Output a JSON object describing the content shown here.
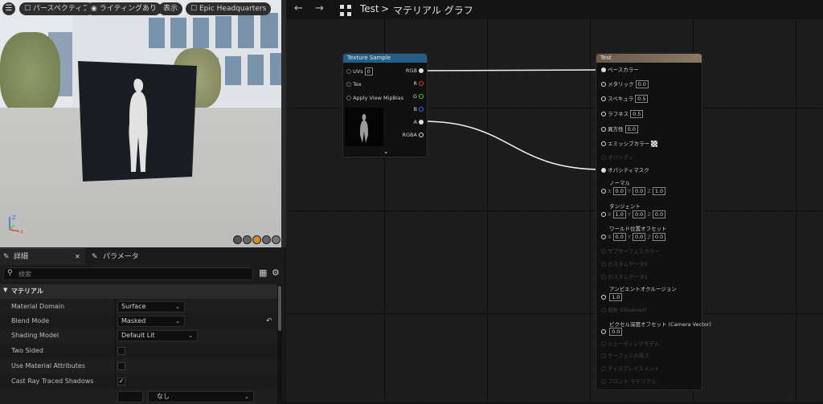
{
  "viewport": {
    "mode_label": "パースペクティブ",
    "lighting_label": "ライティングあり",
    "show_label": "表示",
    "level_label": "Epic Headquarters"
  },
  "graph": {
    "breadcrumb_root": "Test",
    "breadcrumb_sep": ">",
    "breadcrumb_page": "マテリアル グラフ"
  },
  "texture_node": {
    "title": "Texture Sample",
    "inputs": [
      "UVs",
      "Tex",
      "Apply View MipBias"
    ],
    "uvs_value": "0",
    "outputs": [
      "RGB",
      "R",
      "G",
      "B",
      "A",
      "RGBA"
    ]
  },
  "result_node": {
    "title": "Test",
    "base_color": "ベースカラー",
    "metallic": "メタリック",
    "metallic_value": "0.0",
    "specular": "スペキュラ",
    "specular_value": "0.5",
    "roughness": "ラフネス",
    "roughness_value": "0.5",
    "anisotropy": "異方性",
    "anisotropy_value": "0.0",
    "emissive": "エミッシブカラー",
    "opacity": "オパシティ",
    "opacity_mask": "オパシティマスク",
    "normal": "ノーマル",
    "normal_x": "0.0",
    "normal_y": "0.0",
    "normal_z": "1.0",
    "tangent": "タンジェント",
    "tangent_x": "1.0",
    "tangent_y": "0.0",
    "tangent_z": "0.0",
    "wpo": "ワールド位置オフセット",
    "wpo_x": "0.0",
    "wpo_y": "0.0",
    "wpo_z": "0.0",
    "subsurface": "サブサーフェスカラー",
    "custom0": "カスタムデータ0",
    "custom1": "カスタムデータ1",
    "ao": "アンビエントオクルージョン",
    "ao_value": "1.0",
    "refraction": "屈折 (Disabled)",
    "pdo": "ピクセル深度オフセット (Camera Vector)",
    "pdo_value": "0.0",
    "shading_model": "シェーディングモデル",
    "surface_thickness": "サーフェスの厚さ",
    "displacement": "ディスプレイスメント",
    "front_material": "フロント マテリアル",
    "axis_x": "X",
    "axis_y": "Y",
    "axis_z": "Z"
  },
  "details": {
    "tab_details": "詳細",
    "tab_params": "パラメータ",
    "search_placeholder": "検索",
    "section": "マテリアル",
    "rows": [
      {
        "label": "Material Domain",
        "value": "Surface"
      },
      {
        "label": "Blend Mode",
        "value": "Masked"
      },
      {
        "label": "Shading Model",
        "value": "Default Lit"
      },
      {
        "label": "Two Sided",
        "checked": false
      },
      {
        "label": "Use Material Attributes",
        "checked": false
      },
      {
        "label": "Cast Ray Traced Shadows",
        "checked": true
      }
    ],
    "last_value": "なし"
  }
}
